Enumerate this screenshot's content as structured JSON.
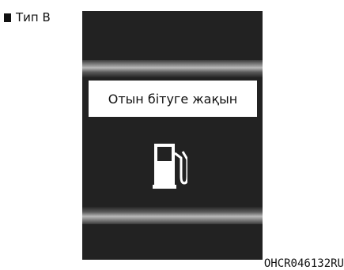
{
  "header": {
    "type_label": "Тип B"
  },
  "display": {
    "message": "Отын бітуге жақын",
    "icon": "fuel-pump-icon"
  },
  "footer": {
    "image_code": "OHCR046132RU"
  },
  "colors": {
    "cluster_background": "#222222",
    "message_background": "#ffffff",
    "icon_color": "#ffffff"
  }
}
